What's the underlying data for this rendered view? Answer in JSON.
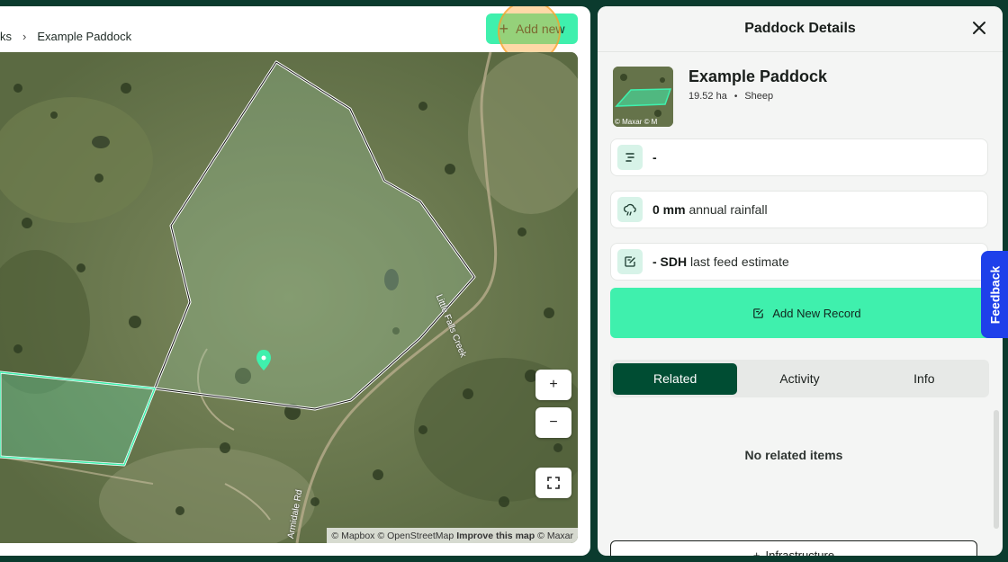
{
  "breadcrumb": {
    "parent": "ks",
    "current": "Example Paddock"
  },
  "toolbar": {
    "add_label": "Add new"
  },
  "map": {
    "road_labels": [
      "Little Falls Creek",
      "Armidale Rd"
    ],
    "controls": {
      "zoom_in": "+",
      "zoom_out": "−",
      "fullscreen_icon": "expand-icon"
    },
    "attribution": {
      "mapbox": "© Mapbox",
      "osm": "© OpenStreetMap",
      "improve": "Improve this map",
      "maxar": "© Maxar"
    }
  },
  "details": {
    "title": "Paddock Details",
    "name": "Example Paddock",
    "area": "19.52 ha",
    "livestock": "Sheep",
    "thumbnail_attribution": "© Maxar © M",
    "stats": [
      {
        "icon": "list-icon",
        "value": "-",
        "label": ""
      },
      {
        "icon": "rain-cloud-icon",
        "value": "0 mm",
        "label": "annual rainfall"
      },
      {
        "icon": "edit-note-icon",
        "value": "- SDH",
        "label": "last feed estimate"
      }
    ],
    "add_record_label": "Add New Record",
    "tabs": [
      {
        "label": "Related",
        "active": true
      },
      {
        "label": "Activity",
        "active": false
      },
      {
        "label": "Info",
        "active": false
      }
    ],
    "empty_message": "No related items",
    "infrastructure_label": "Infrastructure"
  },
  "feedback_label": "Feedback",
  "colors": {
    "accent": "#3ff0ad",
    "dark_green": "#004d33",
    "feedback_blue": "#1e40ea",
    "background": "#0b3b2e"
  }
}
